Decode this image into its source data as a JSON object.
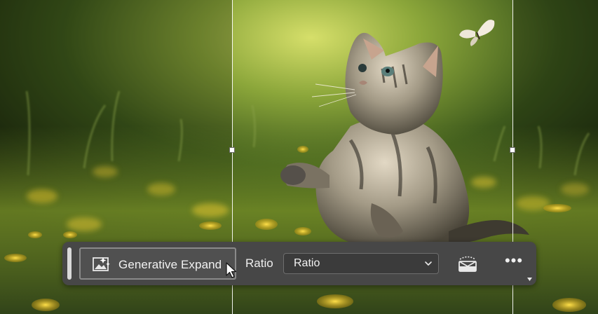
{
  "toolbar": {
    "generate_label": "Generative Expand",
    "ratio_label": "Ratio",
    "ratio_selected": "Ratio",
    "more_label": "•••"
  },
  "icons": {
    "generate": "generative-expand-icon",
    "dropdown": "chevron-down-icon",
    "camera": "camera-adjust-icon",
    "more": "more-options-icon",
    "cursor": "mouse-pointer-icon"
  },
  "colors": {
    "toolbar_bg": "#474747",
    "button_bg": "#505050",
    "text": "#f2f2f2"
  }
}
